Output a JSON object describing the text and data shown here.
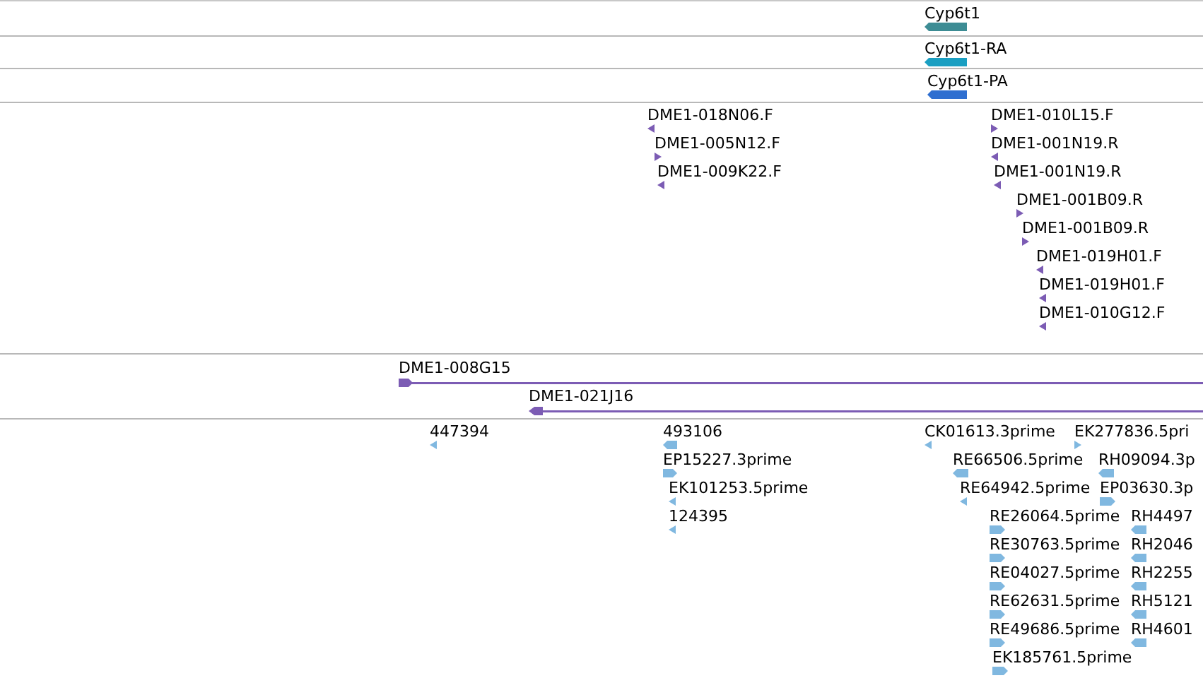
{
  "tracks": [
    {
      "color": "#3d8c94",
      "features": [
        {
          "label": "Cyp6t1",
          "forward": false,
          "kind": "block"
        }
      ]
    },
    {
      "color": "#1a9fc2",
      "features": [
        {
          "label": "Cyp6t1-RA",
          "forward": false,
          "kind": "block"
        }
      ]
    },
    {
      "color": "#2f6fd0",
      "features": [
        {
          "label": "Cyp6t1-PA",
          "forward": false,
          "kind": "block"
        }
      ]
    },
    {
      "color": "#7c5cb4",
      "features": [
        {
          "label": "DME1-018N06.F",
          "forward": false,
          "kind": "tick"
        },
        {
          "label": "DME1-005N12.F",
          "forward": true,
          "kind": "tick"
        },
        {
          "label": "DME1-009K22.F",
          "forward": false,
          "kind": "tick"
        },
        {
          "label": "DME1-010L15.F",
          "forward": true,
          "kind": "tick"
        },
        {
          "label": "DME1-001N19.R",
          "forward": false,
          "kind": "tick"
        },
        {
          "label": "DME1-001N19.R",
          "forward": false,
          "kind": "tick"
        },
        {
          "label": "DME1-001B09.R",
          "forward": true,
          "kind": "tick"
        },
        {
          "label": "DME1-001B09.R",
          "forward": true,
          "kind": "tick"
        },
        {
          "label": "DME1-019H01.F",
          "forward": false,
          "kind": "tick"
        },
        {
          "label": "DME1-019H01.F",
          "forward": false,
          "kind": "tick"
        },
        {
          "label": "DME1-010G12.F",
          "forward": false,
          "kind": "tick"
        }
      ]
    },
    {
      "color": "#7c5cb4",
      "features": [
        {
          "label": "DME1-008G15",
          "forward": true,
          "kind": "span"
        },
        {
          "label": "DME1-021J16",
          "forward": false,
          "kind": "span"
        }
      ]
    },
    {
      "color": "#80b8e0",
      "features": [
        {
          "label": "447394",
          "forward": false,
          "kind": "tick"
        },
        {
          "label": "493106",
          "forward": false,
          "kind": "block"
        },
        {
          "label": "EP15227.3prime",
          "forward": true,
          "kind": "block"
        },
        {
          "label": "EK101253.5prime",
          "forward": false,
          "kind": "tick"
        },
        {
          "label": "124395",
          "forward": false,
          "kind": "tick"
        },
        {
          "label": "CK01613.3prime",
          "forward": false,
          "kind": "tick"
        },
        {
          "label": "EK277836.5pri",
          "forward": true,
          "kind": "tick"
        },
        {
          "label": "RE66506.5prime",
          "forward": false,
          "kind": "block"
        },
        {
          "label": "RH09094.3p",
          "forward": false,
          "kind": "block"
        },
        {
          "label": "RE64942.5prime",
          "forward": false,
          "kind": "tick"
        },
        {
          "label": "EP03630.3p",
          "forward": true,
          "kind": "block"
        },
        {
          "label": "RE26064.5prime",
          "forward": true,
          "kind": "block"
        },
        {
          "label": "RH4497",
          "forward": false,
          "kind": "block"
        },
        {
          "label": "RE30763.5prime",
          "forward": true,
          "kind": "block"
        },
        {
          "label": "RH2046",
          "forward": false,
          "kind": "block"
        },
        {
          "label": "RE04027.5prime",
          "forward": true,
          "kind": "block"
        },
        {
          "label": "RH2255",
          "forward": false,
          "kind": "block"
        },
        {
          "label": "RE62631.5prime",
          "forward": true,
          "kind": "block"
        },
        {
          "label": "RH5121",
          "forward": false,
          "kind": "block"
        },
        {
          "label": "RE49686.5prime",
          "forward": true,
          "kind": "block"
        },
        {
          "label": "RH4601",
          "forward": false,
          "kind": "block"
        },
        {
          "label": "EK185761.5prime",
          "forward": true,
          "kind": "block"
        }
      ]
    }
  ]
}
